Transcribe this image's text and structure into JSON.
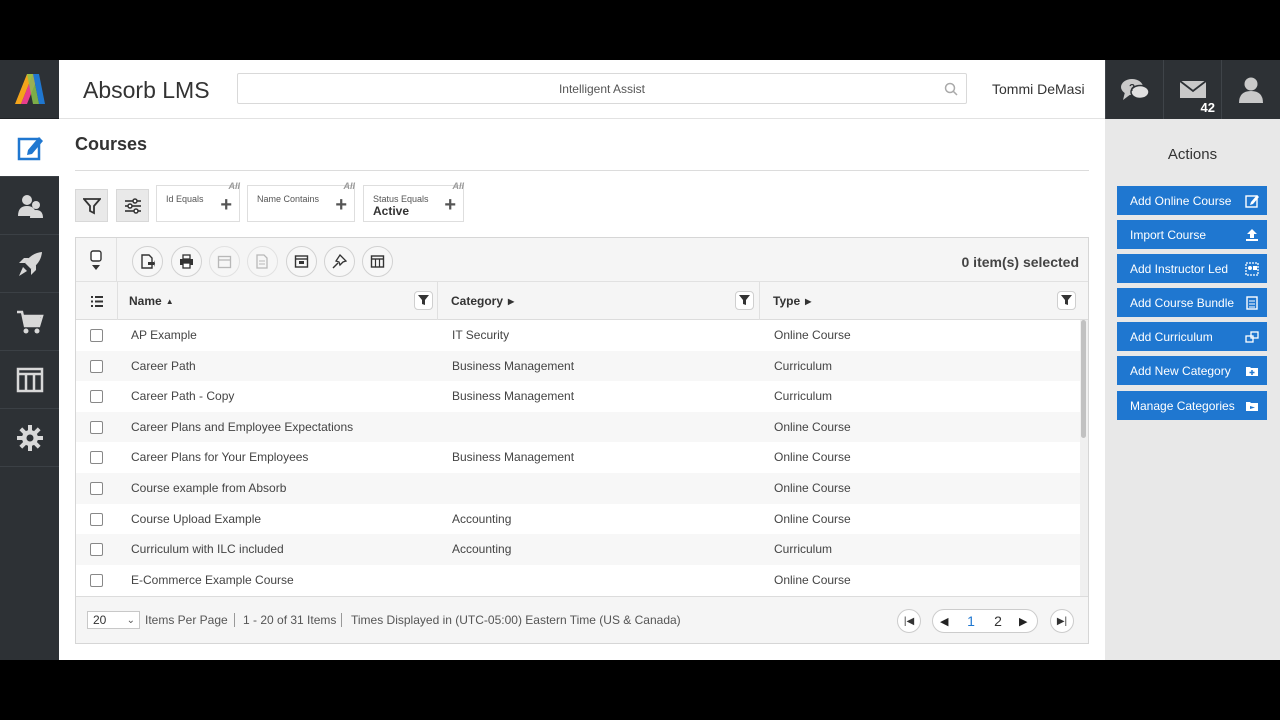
{
  "app": {
    "title": "Absorb LMS",
    "search_placeholder": "Intelligent Assist",
    "user_name": "Tommi DeMasi",
    "message_count": "42"
  },
  "colors": {
    "accent": "#1f77d0",
    "nav_bg": "#2d3135",
    "panel_bg": "#e8e8e8"
  },
  "nav": [
    {
      "name": "courses",
      "icon": "edit-icon",
      "active": true
    },
    {
      "name": "users",
      "icon": "users-icon"
    },
    {
      "name": "launch",
      "icon": "rocket-icon"
    },
    {
      "name": "ecommerce",
      "icon": "cart-icon"
    },
    {
      "name": "reports",
      "icon": "columns-icon"
    },
    {
      "name": "settings",
      "icon": "gear-icon"
    }
  ],
  "page": {
    "title": "Courses"
  },
  "filters": [
    {
      "label": "Id Equals",
      "value": "",
      "all": "All"
    },
    {
      "label": "Name Contains",
      "value": "",
      "all": "All"
    },
    {
      "label": "Status Equals",
      "value": "Active",
      "all": "All"
    }
  ],
  "toolbar": {
    "selected_text": "0 item(s) selected"
  },
  "columns": {
    "name": "Name",
    "category": "Category",
    "type": "Type"
  },
  "rows": [
    {
      "name": "AP Example",
      "category": "IT Security",
      "type": "Online Course"
    },
    {
      "name": "Career Path",
      "category": "Business Management",
      "type": "Curriculum"
    },
    {
      "name": "Career Path - Copy",
      "category": "Business Management",
      "type": "Curriculum"
    },
    {
      "name": "Career Plans and Employee Expectations",
      "category": "",
      "type": "Online Course"
    },
    {
      "name": "Career Plans for Your Employees",
      "category": "Business Management",
      "type": "Online Course"
    },
    {
      "name": "Course example from Absorb",
      "category": "",
      "type": "Online Course"
    },
    {
      "name": "Course Upload Example",
      "category": "Accounting",
      "type": "Online Course"
    },
    {
      "name": "Curriculum with ILC included",
      "category": "Accounting",
      "type": "Curriculum"
    },
    {
      "name": "E-Commerce Example Course",
      "category": "",
      "type": "Online Course"
    }
  ],
  "footer": {
    "page_size": "20",
    "items_per_page": "Items Per Page",
    "range": "1 - 20 of 31 Items",
    "timezone": "Times Displayed in (UTC-05:00) Eastern Time (US & Canada)",
    "pages": [
      "1",
      "2"
    ],
    "current_page": "1"
  },
  "actions": {
    "title": "Actions",
    "buttons": [
      {
        "label": "Add Online Course",
        "icon": "edit-icon"
      },
      {
        "label": "Import Course",
        "icon": "upload-icon"
      },
      {
        "label": "Add Instructor Led",
        "icon": "instructor-icon"
      },
      {
        "label": "Add Course Bundle",
        "icon": "bundle-icon"
      },
      {
        "label": "Add Curriculum",
        "icon": "curriculum-icon"
      },
      {
        "label": "Add New Category",
        "icon": "folder-add-icon"
      },
      {
        "label": "Manage Categories",
        "icon": "folder-icon"
      }
    ]
  }
}
